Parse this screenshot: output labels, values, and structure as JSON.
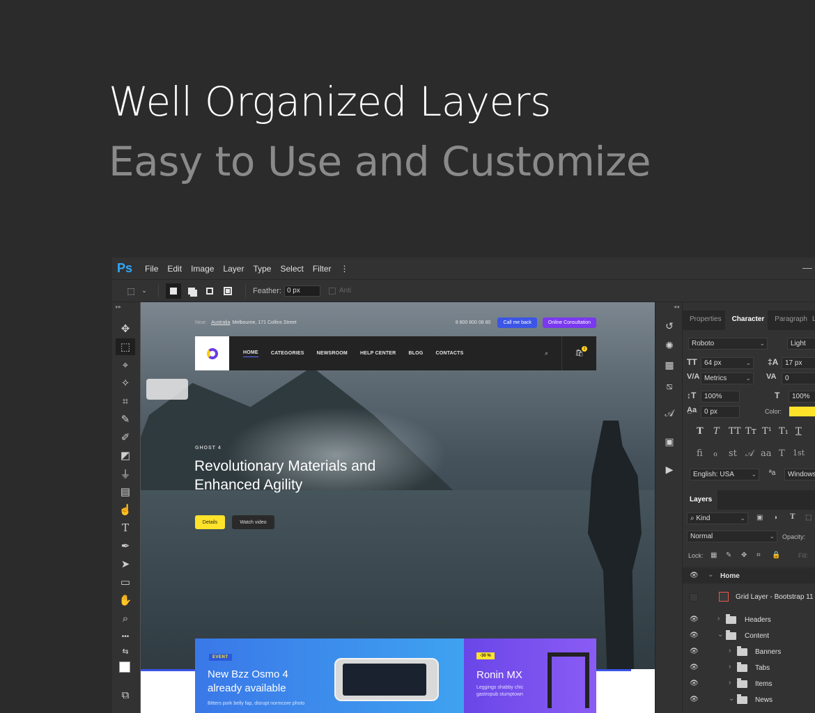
{
  "hero": {
    "title": "Well Organized Layers",
    "subtitle": "Easy to Use and Customize"
  },
  "app": {
    "logo": "Ps",
    "menu": [
      "File",
      "Edit",
      "Image",
      "Layer",
      "Type",
      "Select",
      "Filter"
    ],
    "menu_more": "⋮",
    "window_minimize": "—",
    "options": {
      "feather_label": "Feather:",
      "feather_value": "0 px",
      "anti_alias_label": "Anti"
    },
    "toolbar_collapse": "▸▸",
    "iconstrip_collapse": "◂◂",
    "tools": [
      {
        "name": "move-tool-icon",
        "glyph": "✥"
      },
      {
        "name": "marquee-tool-icon",
        "glyph": "⬚"
      },
      {
        "name": "lasso-tool-icon",
        "glyph": "⌖"
      },
      {
        "name": "magic-wand-tool-icon",
        "glyph": "✧"
      },
      {
        "name": "crop-tool-icon",
        "glyph": "⌗"
      },
      {
        "name": "eyedropper-tool-icon",
        "glyph": "✎"
      },
      {
        "name": "brush-tool-icon",
        "glyph": "✐"
      },
      {
        "name": "eraser-tool-icon",
        "glyph": "◩"
      },
      {
        "name": "stamp-tool-icon",
        "glyph": "⏚"
      },
      {
        "name": "gradient-tool-icon",
        "glyph": "▤"
      },
      {
        "name": "smudge-tool-icon",
        "glyph": "☝"
      },
      {
        "name": "type-tool-icon",
        "glyph": "T"
      },
      {
        "name": "pen-tool-icon",
        "glyph": "✒"
      },
      {
        "name": "path-selection-tool-icon",
        "glyph": "➤"
      },
      {
        "name": "rectangle-tool-icon",
        "glyph": "▭"
      },
      {
        "name": "hand-tool-icon",
        "glyph": "✋"
      },
      {
        "name": "zoom-tool-icon",
        "glyph": "⌕"
      },
      {
        "name": "more-tools-icon",
        "glyph": "•••"
      },
      {
        "name": "swap-colors-icon",
        "glyph": "⇆"
      },
      {
        "name": "color-swatches-icon",
        "glyph": "◧"
      },
      {
        "name": "screen-mode-icon",
        "glyph": "⧉"
      }
    ],
    "panel_icons": [
      {
        "name": "history-icon",
        "glyph": "↺"
      },
      {
        "name": "color-palette-icon",
        "glyph": "✺"
      },
      {
        "name": "swatches-grid-icon",
        "glyph": "▦"
      },
      {
        "name": "adjustments-icon",
        "glyph": "⧅"
      },
      {
        "name": "glyphs-icon",
        "glyph": "𝒜"
      },
      {
        "name": "libraries-icon",
        "glyph": "▣"
      },
      {
        "name": "actions-play-icon",
        "glyph": "▶"
      }
    ]
  },
  "website": {
    "near_label": "Near:",
    "country": "Australia",
    "address": "Melbourne, 171 Collins Street",
    "phone": "8 800 800 08 80",
    "call_btn": "Call me back",
    "consult_btn": "Online Consultation",
    "nav": [
      "HOME",
      "CATEGORIES",
      "NEWSROOM",
      "HELP CENTER",
      "BLOG",
      "CONTACTS"
    ],
    "search_icon": "⌕",
    "cart_icon": "🛍",
    "cart_count": "1",
    "eyebrow": "GHOST 4",
    "banner_title": "Revolutionary Materials and Enhanced Agility",
    "details_btn": "Details",
    "watch_btn": "Watch video",
    "event_badge": "EVENT",
    "event_title": "New Bzz Osmo 4 already available",
    "event_desc": "Bitters pork belly fap, disrupt normcore photo",
    "discount": "-30 %",
    "ronin_title": "Ronin MX",
    "ronin_desc": "Leggings shabby chic gastropub stumptown"
  },
  "character": {
    "tabs": [
      "Properties",
      "Character",
      "Paragraph",
      "L"
    ],
    "font_family": "Roboto",
    "font_style": "Light",
    "font_size": "64 px",
    "leading": "17 px",
    "kerning": "Metrics",
    "tracking": "0",
    "vertical_scale": "100%",
    "horizontal_scale": "100%",
    "baseline_shift": "0 px",
    "color_label": "Color:",
    "color": "#ffe32a",
    "style_buttons": [
      "T",
      "T",
      "TT",
      "Tт",
      "T¹",
      "T₁",
      "T"
    ],
    "opentype_buttons": [
      "fi",
      "ℴ",
      "st",
      "𝒜",
      "aa",
      "T",
      "1st"
    ],
    "language": "English: USA",
    "aa_label": "ªa",
    "antialias": "Windows"
  },
  "layers": {
    "tab": "Layers",
    "kind": "Kind",
    "blend_mode": "Normal",
    "opacity_label": "Opacity:",
    "lock_label": "Lock:",
    "fill_label": "Fill:",
    "rows": [
      {
        "name": "Home",
        "visible": true,
        "open": true
      },
      {
        "name": "Grid Layer - Bootstrap 11",
        "visible": false
      },
      {
        "name": "Headers",
        "visible": true,
        "open": false
      },
      {
        "name": "Content",
        "visible": true,
        "open": true
      },
      {
        "name": "Banners",
        "visible": true,
        "open": false
      },
      {
        "name": "Tabs",
        "visible": true,
        "open": false
      },
      {
        "name": "Items",
        "visible": true,
        "open": false
      },
      {
        "name": "News",
        "visible": true,
        "open": true
      }
    ]
  }
}
